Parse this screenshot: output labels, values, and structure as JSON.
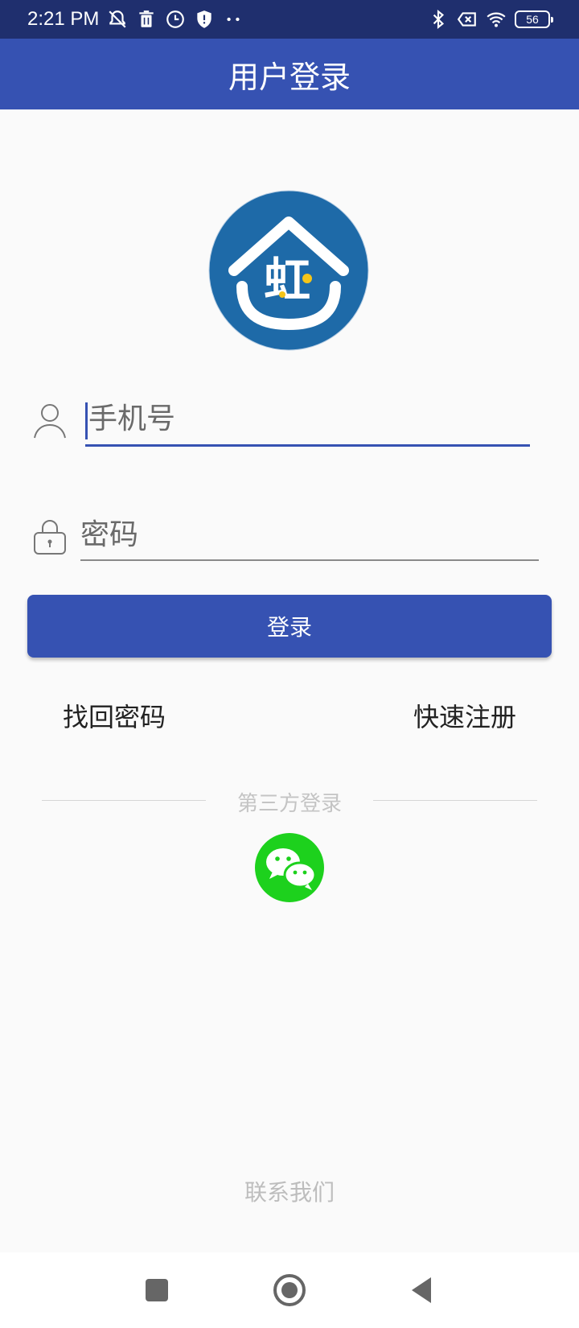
{
  "status_bar": {
    "time": "2:21 PM",
    "battery_level": "56",
    "icons_left": [
      "notifications-off-icon",
      "trash-icon",
      "clock-icon",
      "shield-icon",
      "more-dots-icon"
    ],
    "icons_right": [
      "bluetooth-icon",
      "sim-x-icon",
      "wifi-icon",
      "battery-icon"
    ]
  },
  "app_bar": {
    "title": "用户登录"
  },
  "logo": {
    "text": "虹",
    "brand_color": "#1e6aa8",
    "accent_color": "#f5c518"
  },
  "form": {
    "phone": {
      "placeholder": "手机号",
      "value": ""
    },
    "password": {
      "placeholder": "密码",
      "value": ""
    },
    "login_label": "登录"
  },
  "links": {
    "forgot_password": "找回密码",
    "quick_register": "快速注册"
  },
  "third_party": {
    "label": "第三方登录",
    "wechat_color": "#1dd11d"
  },
  "footer": {
    "contact": "联系我们"
  },
  "colors": {
    "primary": "#3652b2",
    "status_bar": "#1f2f6e"
  }
}
